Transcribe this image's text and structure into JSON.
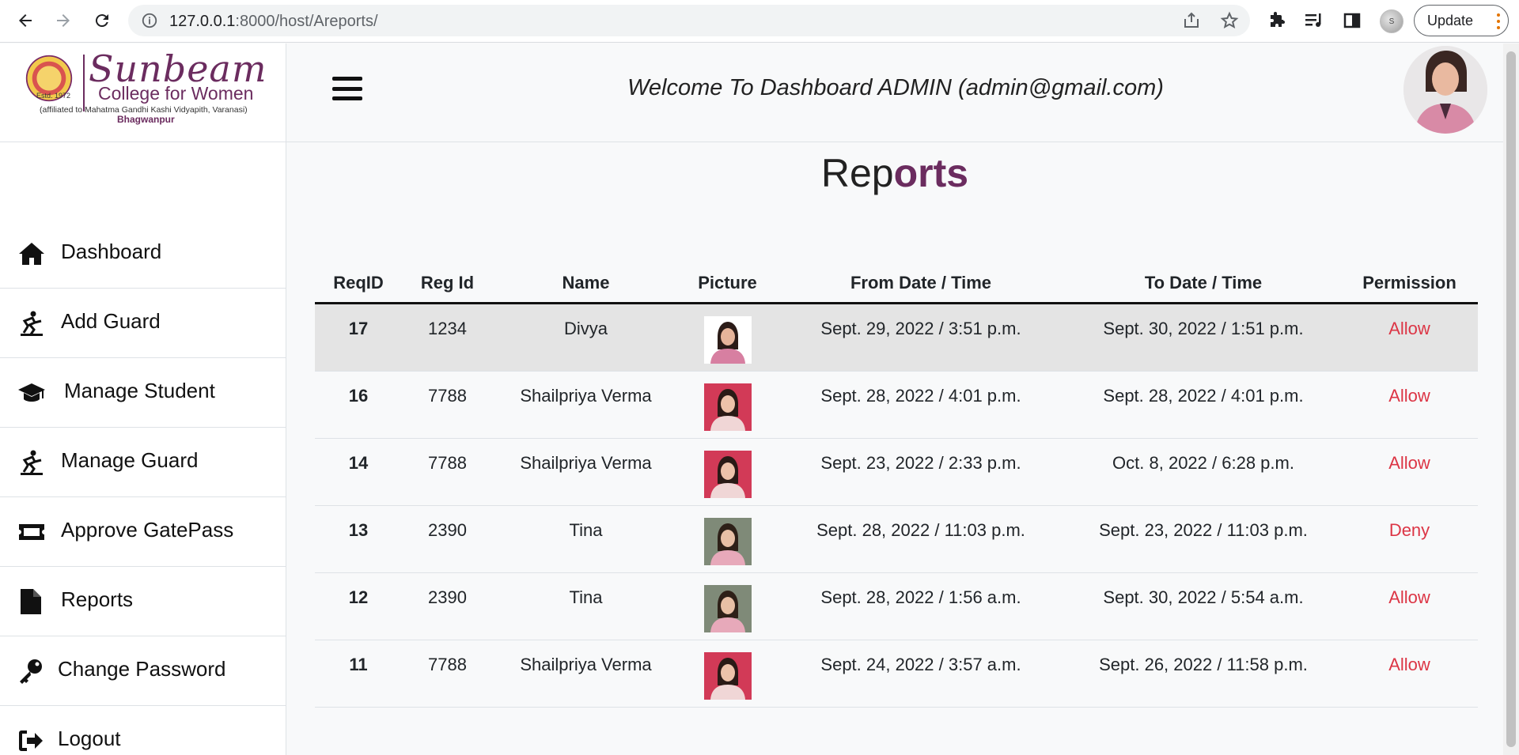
{
  "browser": {
    "url_host": "127.0.0.1",
    "url_path": ":8000/host/Areports/",
    "profile_initial": "S",
    "update_label": "Update"
  },
  "logo": {
    "name": "Sunbeam",
    "subtitle": "College for Women",
    "affiliation": "(affiliated to Mahatma Gandhi Kashi Vidyapith, Varanasi)",
    "place": "Bhagwanpur",
    "estd": "Estd. 1972"
  },
  "header": {
    "welcome": "Welcome To Dashboard ADMIN (admin@gmail.com)"
  },
  "sidebar": {
    "items": [
      {
        "label": "Dashboard",
        "icon": "home-icon"
      },
      {
        "label": "Add Guard",
        "icon": "guard-icon"
      },
      {
        "label": "Manage Student",
        "icon": "graduation-cap-icon"
      },
      {
        "label": "Manage Guard",
        "icon": "guard-icon"
      },
      {
        "label": "Approve GatePass",
        "icon": "ticket-icon"
      },
      {
        "label": "Reports",
        "icon": "file-icon"
      },
      {
        "label": "Change Password",
        "icon": "key-icon"
      },
      {
        "label": "Logout",
        "icon": "sign-out-icon"
      }
    ]
  },
  "page": {
    "title_plain": "Rep",
    "title_accent": "orts"
  },
  "table": {
    "headers": [
      "ReqID",
      "Reg Id",
      "Name",
      "Picture",
      "From Date / Time",
      "To Date / Time",
      "Permission"
    ],
    "rows": [
      {
        "req_id": "17",
        "reg_id": "1234",
        "name": "Divya",
        "from": "Sept. 29, 2022 / 3:51 p.m.",
        "to": "Sept. 30, 2022 / 1:51 p.m.",
        "permission": "Allow",
        "photo": "divya"
      },
      {
        "req_id": "16",
        "reg_id": "7788",
        "name": "Shailpriya Verma",
        "from": "Sept. 28, 2022 / 4:01 p.m.",
        "to": "Sept. 28, 2022 / 4:01 p.m.",
        "permission": "Allow",
        "photo": "shailpriya"
      },
      {
        "req_id": "14",
        "reg_id": "7788",
        "name": "Shailpriya Verma",
        "from": "Sept. 23, 2022 / 2:33 p.m.",
        "to": "Oct. 8, 2022 / 6:28 p.m.",
        "permission": "Allow",
        "photo": "shailpriya"
      },
      {
        "req_id": "13",
        "reg_id": "2390",
        "name": "Tina",
        "from": "Sept. 28, 2022 / 11:03 p.m.",
        "to": "Sept. 23, 2022 / 11:03 p.m.",
        "permission": "Deny",
        "photo": "tina"
      },
      {
        "req_id": "12",
        "reg_id": "2390",
        "name": "Tina",
        "from": "Sept. 28, 2022 / 1:56 a.m.",
        "to": "Sept. 30, 2022 / 5:54 a.m.",
        "permission": "Allow",
        "photo": "tina"
      },
      {
        "req_id": "11",
        "reg_id": "7788",
        "name": "Shailpriya Verma",
        "from": "Sept. 24, 2022 / 3:57 a.m.",
        "to": "Sept. 26, 2022 / 11:58 p.m.",
        "permission": "Allow",
        "photo": "shailpriya"
      }
    ]
  },
  "colors": {
    "brand": "#6b2c5f",
    "permission": "#dc3545",
    "highlight_row": "#e4e4e4"
  }
}
